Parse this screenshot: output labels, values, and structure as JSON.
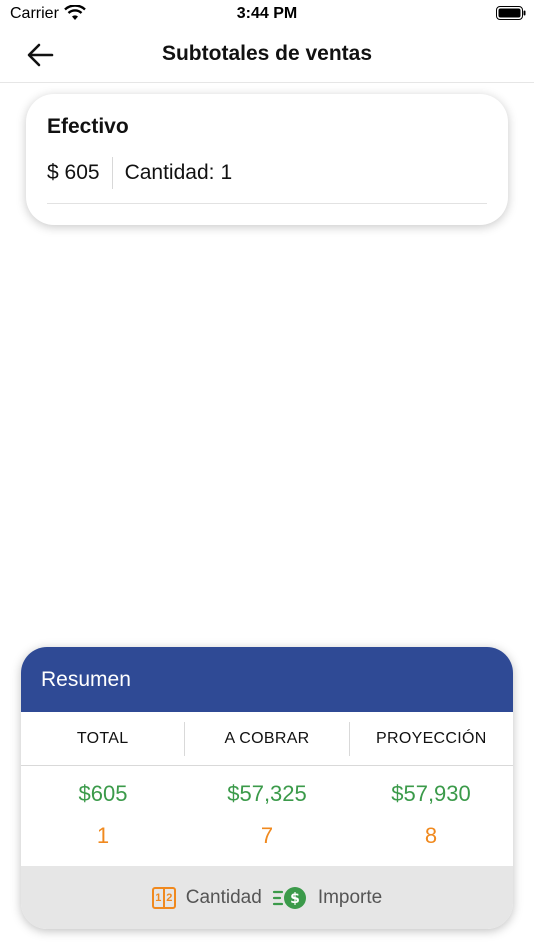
{
  "status_bar": {
    "carrier": "Carrier",
    "time": "3:44 PM"
  },
  "nav": {
    "title": "Subtotales de ventas"
  },
  "card": {
    "title": "Efectivo",
    "amount": "$ 605",
    "qty_label": "Cantidad:",
    "qty_value": "1"
  },
  "summary": {
    "title": "Resumen",
    "columns": [
      {
        "header": "TOTAL",
        "amount": "$605",
        "count": "1"
      },
      {
        "header": "A COBRAR",
        "amount": "$57,325",
        "count": "7"
      },
      {
        "header": "PROYECCIÓN",
        "amount": "$57,930",
        "count": "8"
      }
    ],
    "legend": {
      "qty_label": "Cantidad",
      "amount_label": "Importe"
    }
  },
  "colors": {
    "header_bg": "#2f4a95",
    "amount": "#3b9a4a",
    "count": "#f0891e"
  },
  "icons": [
    "wifi-icon",
    "battery-icon",
    "back-arrow-icon",
    "quantity-icon",
    "money-icon"
  ]
}
